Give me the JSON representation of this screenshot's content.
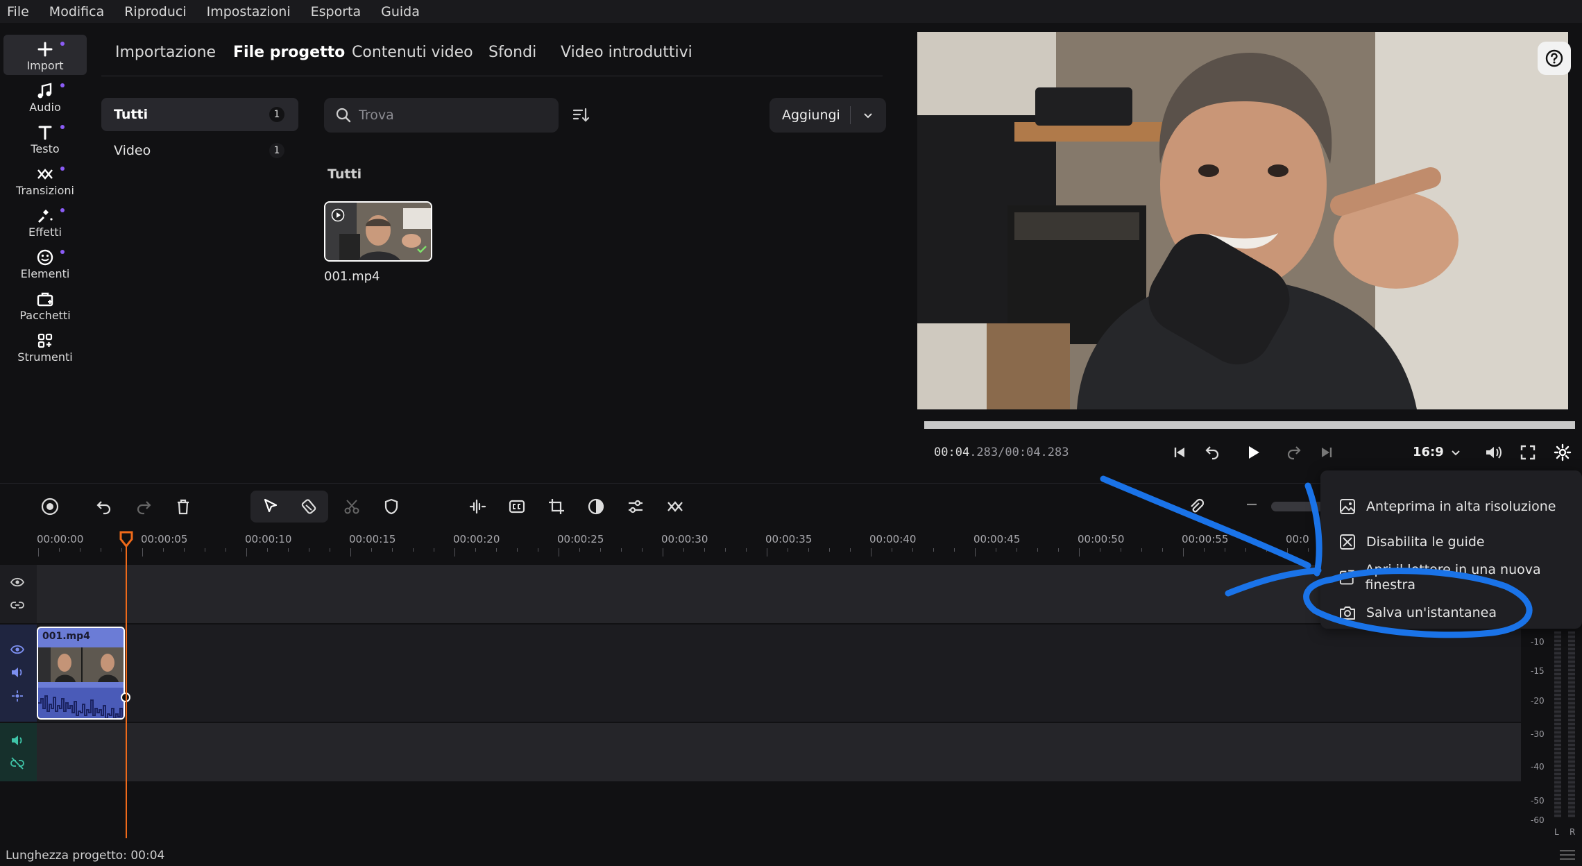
{
  "menu": [
    "File",
    "Modifica",
    "Riproduci",
    "Impostazioni",
    "Esporta",
    "Guida"
  ],
  "rail": [
    {
      "label": "Import",
      "icon": "plus-icon"
    },
    {
      "label": "Audio",
      "icon": "music-note-icon"
    },
    {
      "label": "Testo",
      "icon": "text-icon"
    },
    {
      "label": "Transizioni",
      "icon": "transition-icon"
    },
    {
      "label": "Effetti",
      "icon": "effects-icon"
    },
    {
      "label": "Elementi",
      "icon": "smiley-icon"
    },
    {
      "label": "Pacchetti",
      "icon": "package-icon"
    },
    {
      "label": "Strumenti",
      "icon": "tools-grid-icon"
    }
  ],
  "tabs": [
    "Importazione",
    "File progetto",
    "Contenuti video",
    "Sfondi",
    "Video introduttivi"
  ],
  "categories": [
    {
      "label": "Tutti",
      "count": "1"
    },
    {
      "label": "Video",
      "count": "1"
    }
  ],
  "search": {
    "placeholder": "Trova"
  },
  "add_button": {
    "label": "Aggiungi"
  },
  "media": {
    "section_title": "Tutti",
    "file_name": "001.mp4"
  },
  "player": {
    "time_current": "00:04",
    "time_current_ms": ".283",
    "time_total": "/00:04.283",
    "aspect_ratio": "16:9",
    "progress": 1.0
  },
  "ruler": [
    "00:00:00",
    "00:00:05",
    "00:00:10",
    "00:00:15",
    "00:00:20",
    "00:00:25",
    "00:00:30",
    "00:00:35",
    "00:00:40",
    "00:00:45",
    "00:00:50",
    "00:00:55",
    "00:0"
  ],
  "clip": {
    "name": "001.mp4"
  },
  "status": {
    "text": "Lunghezza progetto: 00:04"
  },
  "meter": {
    "labels": [
      "-10",
      "-15",
      "-20",
      "-30",
      "-40",
      "-50",
      "-60"
    ],
    "channels": [
      "L",
      "R"
    ]
  },
  "context_menu": [
    {
      "label": "Anteprima in alta risoluzione",
      "icon": "image-icon"
    },
    {
      "label": "Disabilita le guide",
      "icon": "guides-off-icon"
    },
    {
      "label": "Apri il lettore in una nuova finestra",
      "icon": "external-window-icon"
    },
    {
      "label": "Salva un'istantanea",
      "icon": "camera-icon"
    }
  ],
  "colors": {
    "accent_purple": "#8b5cf6",
    "playhead": "#ef6a1a",
    "clip": "#6b7cd6",
    "annotation": "#1a73e8"
  }
}
